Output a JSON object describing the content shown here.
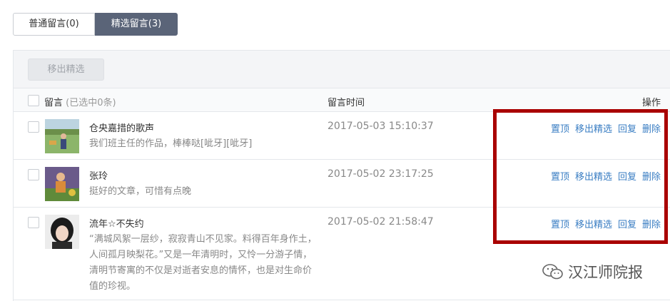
{
  "tabs": [
    {
      "label": "普通留言(0)",
      "active": false
    },
    {
      "label": "精选留言(3)",
      "active": true
    }
  ],
  "toolbar": {
    "remove_label": "移出精选"
  },
  "header": {
    "message": "留言",
    "selected": "(已选中0条)",
    "time": "留言时间",
    "action": "操作"
  },
  "rows": [
    {
      "name": "仓央嘉措的歌声",
      "content": "我们班主任的作品，棒棒哒[呲牙][呲牙]",
      "time": "2017-05-03 15:10:37",
      "avatar": "green-field-photo-avatar"
    },
    {
      "name": "张玲",
      "content": "挺好的文章，可惜有点晚",
      "time": "2017-05-02 23:17:25",
      "avatar": "child-photo-avatar"
    },
    {
      "name": "流年☆不失约",
      "content": "“满城风絮一层纱，寂寂青山不见家。料得百年身作土，人间孤月映梨花。”又是一年清明时，又怜一分游子情，清明节寄寓的不仅是对逝者安息的情怀，也是对生命价值的珍视。",
      "time": "2017-05-02 21:58:47",
      "avatar": "girl-portrait-avatar"
    }
  ],
  "ops": {
    "pin": "置顶",
    "remove": "移出精选",
    "reply": "回复",
    "delete": "删除"
  },
  "watermark": {
    "text": "汉江师院报",
    "icon": "wechat-icon"
  },
  "colors": {
    "tab_active": "#5a6478",
    "link": "#3a7ec3",
    "highlight_box": "#a90000"
  }
}
